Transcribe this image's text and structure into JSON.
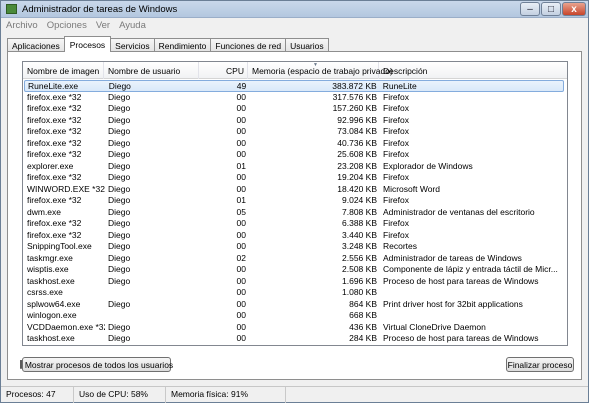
{
  "window": {
    "title": "Administrador de tareas de Windows"
  },
  "window_controls": {
    "minimize": "–",
    "maximize": "□",
    "close": "x"
  },
  "menu": [
    "Archivo",
    "Opciones",
    "Ver",
    "Ayuda"
  ],
  "tabs": [
    {
      "label": "Aplicaciones",
      "active": false
    },
    {
      "label": "Procesos",
      "active": true
    },
    {
      "label": "Servicios",
      "active": false
    },
    {
      "label": "Rendimiento",
      "active": false
    },
    {
      "label": "Funciones de red",
      "active": false
    },
    {
      "label": "Usuarios",
      "active": false
    }
  ],
  "columns": [
    "Nombre de imagen",
    "Nombre de usuario",
    "CPU",
    "Memoria (espacio de trabajo privado)",
    "Descripción"
  ],
  "sorted_column": "Memoria (espacio de trabajo privado)",
  "processes": [
    [
      "RuneLite.exe",
      "Diego",
      "49",
      "383.872 KB",
      "RuneLite"
    ],
    [
      "firefox.exe *32",
      "Diego",
      "00",
      "317.576 KB",
      "Firefox"
    ],
    [
      "firefox.exe *32",
      "Diego",
      "00",
      "157.260 KB",
      "Firefox"
    ],
    [
      "firefox.exe *32",
      "Diego",
      "00",
      "92.996 KB",
      "Firefox"
    ],
    [
      "firefox.exe *32",
      "Diego",
      "00",
      "73.084 KB",
      "Firefox"
    ],
    [
      "firefox.exe *32",
      "Diego",
      "00",
      "40.736 KB",
      "Firefox"
    ],
    [
      "firefox.exe *32",
      "Diego",
      "00",
      "25.608 KB",
      "Firefox"
    ],
    [
      "explorer.exe",
      "Diego",
      "01",
      "23.208 KB",
      "Explorador de Windows"
    ],
    [
      "firefox.exe *32",
      "Diego",
      "00",
      "19.204 KB",
      "Firefox"
    ],
    [
      "WINWORD.EXE *32",
      "Diego",
      "00",
      "18.420 KB",
      "Microsoft Word"
    ],
    [
      "firefox.exe *32",
      "Diego",
      "01",
      "9.024 KB",
      "Firefox"
    ],
    [
      "dwm.exe",
      "Diego",
      "05",
      "7.808 KB",
      "Administrador de ventanas del escritorio"
    ],
    [
      "firefox.exe *32",
      "Diego",
      "00",
      "6.388 KB",
      "Firefox"
    ],
    [
      "firefox.exe *32",
      "Diego",
      "00",
      "3.440 KB",
      "Firefox"
    ],
    [
      "SnippingTool.exe",
      "Diego",
      "00",
      "3.248 KB",
      "Recortes"
    ],
    [
      "taskmgr.exe",
      "Diego",
      "02",
      "2.556 KB",
      "Administrador de tareas de Windows"
    ],
    [
      "wisptis.exe",
      "Diego",
      "00",
      "2.508 KB",
      "Componente de lápiz y entrada táctil de Micr..."
    ],
    [
      "taskhost.exe",
      "Diego",
      "00",
      "1.696 KB",
      "Proceso de host para tareas de Windows"
    ],
    [
      "csrss.exe",
      "",
      "00",
      "1.080 KB",
      ""
    ],
    [
      "splwow64.exe",
      "Diego",
      "00",
      "864 KB",
      "Print driver host for 32bit applications"
    ],
    [
      "winlogon.exe",
      "",
      "00",
      "668 KB",
      ""
    ],
    [
      "VCDDaemon.exe *32",
      "Diego",
      "00",
      "436 KB",
      "Virtual CloneDrive Daemon"
    ],
    [
      "taskhost.exe",
      "Diego",
      "00",
      "284 KB",
      "Proceso de host para tareas de Windows"
    ]
  ],
  "selected_row": 0,
  "buttons": {
    "show_all": "Mostrar procesos de todos los usuarios",
    "end_process": "Finalizar proceso"
  },
  "status": {
    "processes": "Procesos: 47",
    "cpu": "Uso de CPU: 58%",
    "memory": "Memoria física: 91%"
  }
}
